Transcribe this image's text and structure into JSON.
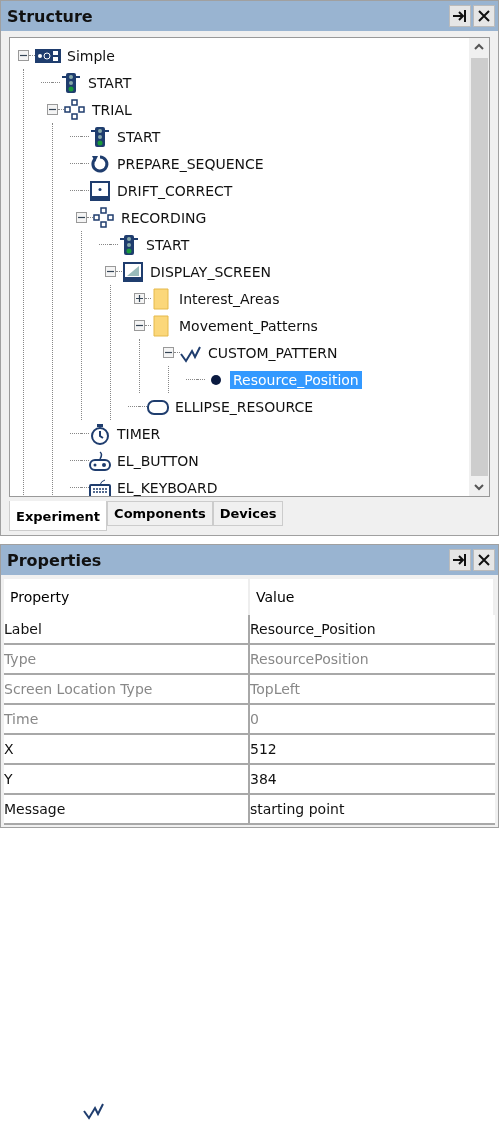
{
  "structure_panel": {
    "title": "Structure",
    "tree": [
      {
        "label": "Simple",
        "kind": "experiment",
        "expanded": true,
        "selected": false,
        "children": [
          {
            "label": "START",
            "kind": "start",
            "selected": false
          },
          {
            "label": "TRIAL",
            "kind": "sequence",
            "expanded": true,
            "selected": false,
            "children": [
              {
                "label": "START",
                "kind": "start",
                "selected": false
              },
              {
                "label": "PREPARE_SEQUENCE",
                "kind": "prepare",
                "selected": false
              },
              {
                "label": "DRIFT_CORRECT",
                "kind": "drift",
                "selected": false
              },
              {
                "label": "RECORDING",
                "kind": "sequence",
                "expanded": true,
                "selected": false,
                "children": [
                  {
                    "label": "START",
                    "kind": "start",
                    "selected": false
                  },
                  {
                    "label": "DISPLAY_SCREEN",
                    "kind": "display",
                    "expanded": true,
                    "selected": false,
                    "children": [
                      {
                        "label": "Interest_Areas",
                        "kind": "folder",
                        "expanded": false,
                        "selected": false
                      },
                      {
                        "label": "Movement_Patterns",
                        "kind": "folder",
                        "expanded": true,
                        "selected": false,
                        "children": [
                          {
                            "label": "CUSTOM_PATTERN",
                            "kind": "pattern",
                            "expanded": true,
                            "selected": false,
                            "children": [
                              {
                                "label": "Resource_Position",
                                "kind": "point",
                                "selected": true
                              }
                            ]
                          }
                        ]
                      },
                      {
                        "label": "ELLIPSE_RESOURCE",
                        "kind": "ellipse",
                        "selected": false
                      }
                    ]
                  }
                ]
              },
              {
                "label": "TIMER",
                "kind": "timer",
                "selected": false
              },
              {
                "label": "EL_BUTTON",
                "kind": "gamepad",
                "selected": false
              },
              {
                "label": "EL_KEYBOARD",
                "kind": "keyboard",
                "selected": false
              }
            ]
          }
        ]
      }
    ],
    "tabs": [
      {
        "label": "Experiment",
        "selected": true
      },
      {
        "label": "Components",
        "selected": false
      },
      {
        "label": "Devices",
        "selected": false
      }
    ]
  },
  "properties_panel": {
    "title": "Properties",
    "columns": [
      "Property",
      "Value"
    ],
    "rows": [
      {
        "property": "Label",
        "value": "Resource_Position",
        "disabled": false
      },
      {
        "property": "Type",
        "value": "ResourcePosition",
        "disabled": true
      },
      {
        "property": "Screen Location Type",
        "value": "TopLeft",
        "disabled": true
      },
      {
        "property": "Time",
        "value": "0",
        "disabled": true
      },
      {
        "property": "X",
        "value": "512",
        "disabled": false
      },
      {
        "property": "Y",
        "value": "384",
        "disabled": false
      },
      {
        "property": "Message",
        "value": "starting point",
        "disabled": false
      }
    ]
  }
}
